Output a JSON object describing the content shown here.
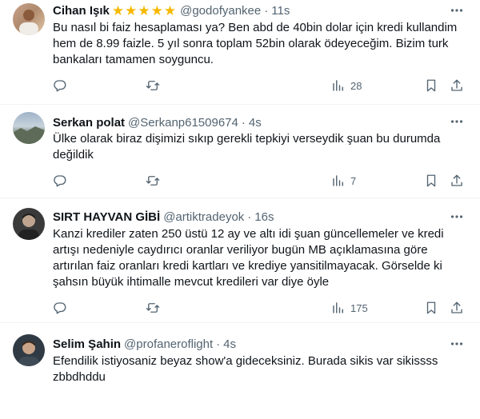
{
  "icons": {
    "more": "more-dots-icon",
    "reply": "reply-icon",
    "retweet": "retweet-icon",
    "views": "views-chart-icon",
    "bookmark": "bookmark-icon",
    "share": "share-icon",
    "star": "star-emoji"
  },
  "colors": {
    "text": "#0f1419",
    "muted": "#536471",
    "divider": "#eff3f4",
    "star": "#f5b800"
  },
  "tweets": [
    {
      "name": "Cihan Işık",
      "star_count": 5,
      "handle": "@godofyankee",
      "separator": "·",
      "time": "11s",
      "text": "Bu nasıl bi faiz hesaplaması ya? Ben abd de 40bin dolar için kredi kullandim hem de 8.99 faizle. 5 yıl sonra toplam 52bin olarak ödeyeceğim. Bizim turk bankaları tamamen soyguncu.",
      "views": "28"
    },
    {
      "name": "Serkan polat",
      "handle": "@Serkanp61509674",
      "separator": "·",
      "time": "4s",
      "text": "Ülke olarak biraz dişimizi sıkıp gerekli tepkiyi verseydik şuan bu durumda değildik",
      "views": "7"
    },
    {
      "name": "SIRT HAYVAN GİBİ",
      "handle": "@artiktradeyok",
      "separator": "·",
      "time": "16s",
      "text": "Kanzi krediler zaten 250 üstü 12 ay ve altı idi şuan güncellemeler ve kredi artışı nedeniyle caydırıcı oranlar veriliyor bugün MB açıklamasına göre artırılan faiz oranları kredi kartları ve krediye yansitilmayacak. Görselde ki şahsın büyük ihtimalle mevcut kredileri var diye öyle",
      "views": "175"
    },
    {
      "name": "Selim Şahin",
      "handle": "@profaneroflight",
      "separator": "·",
      "time": "4s",
      "text": "Efendilik istiyosaniz beyaz show'a gideceksiniz. Burada sikis var sikissss zbbdhddu",
      "views": ""
    }
  ]
}
